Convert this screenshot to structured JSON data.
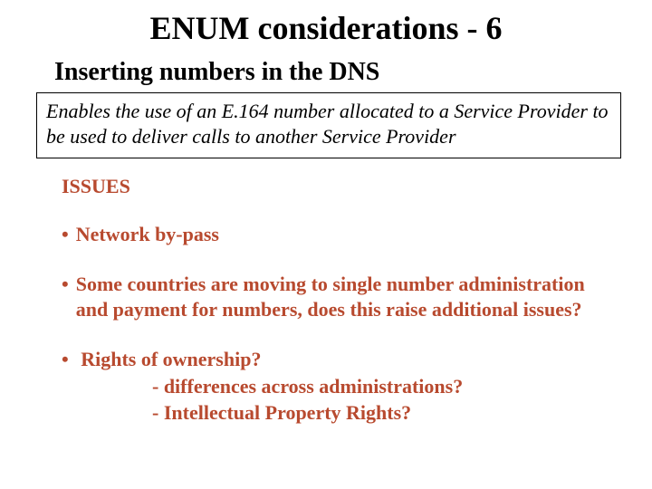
{
  "title": "ENUM considerations - 6",
  "subtitle": "Inserting numbers in the DNS",
  "box_text": "Enables the use of an E.164 number allocated to a Service Provider to be used to deliver calls to another Service Provider",
  "issues": {
    "heading": "ISSUES",
    "bullets": [
      "Network by-pass",
      "Some countries are moving to single number administration and payment for numbers,  does this raise additional issues?",
      "Rights of ownership?"
    ],
    "sub": [
      "-  differences across administrations?",
      "-   Intellectual Property Rights?"
    ]
  }
}
